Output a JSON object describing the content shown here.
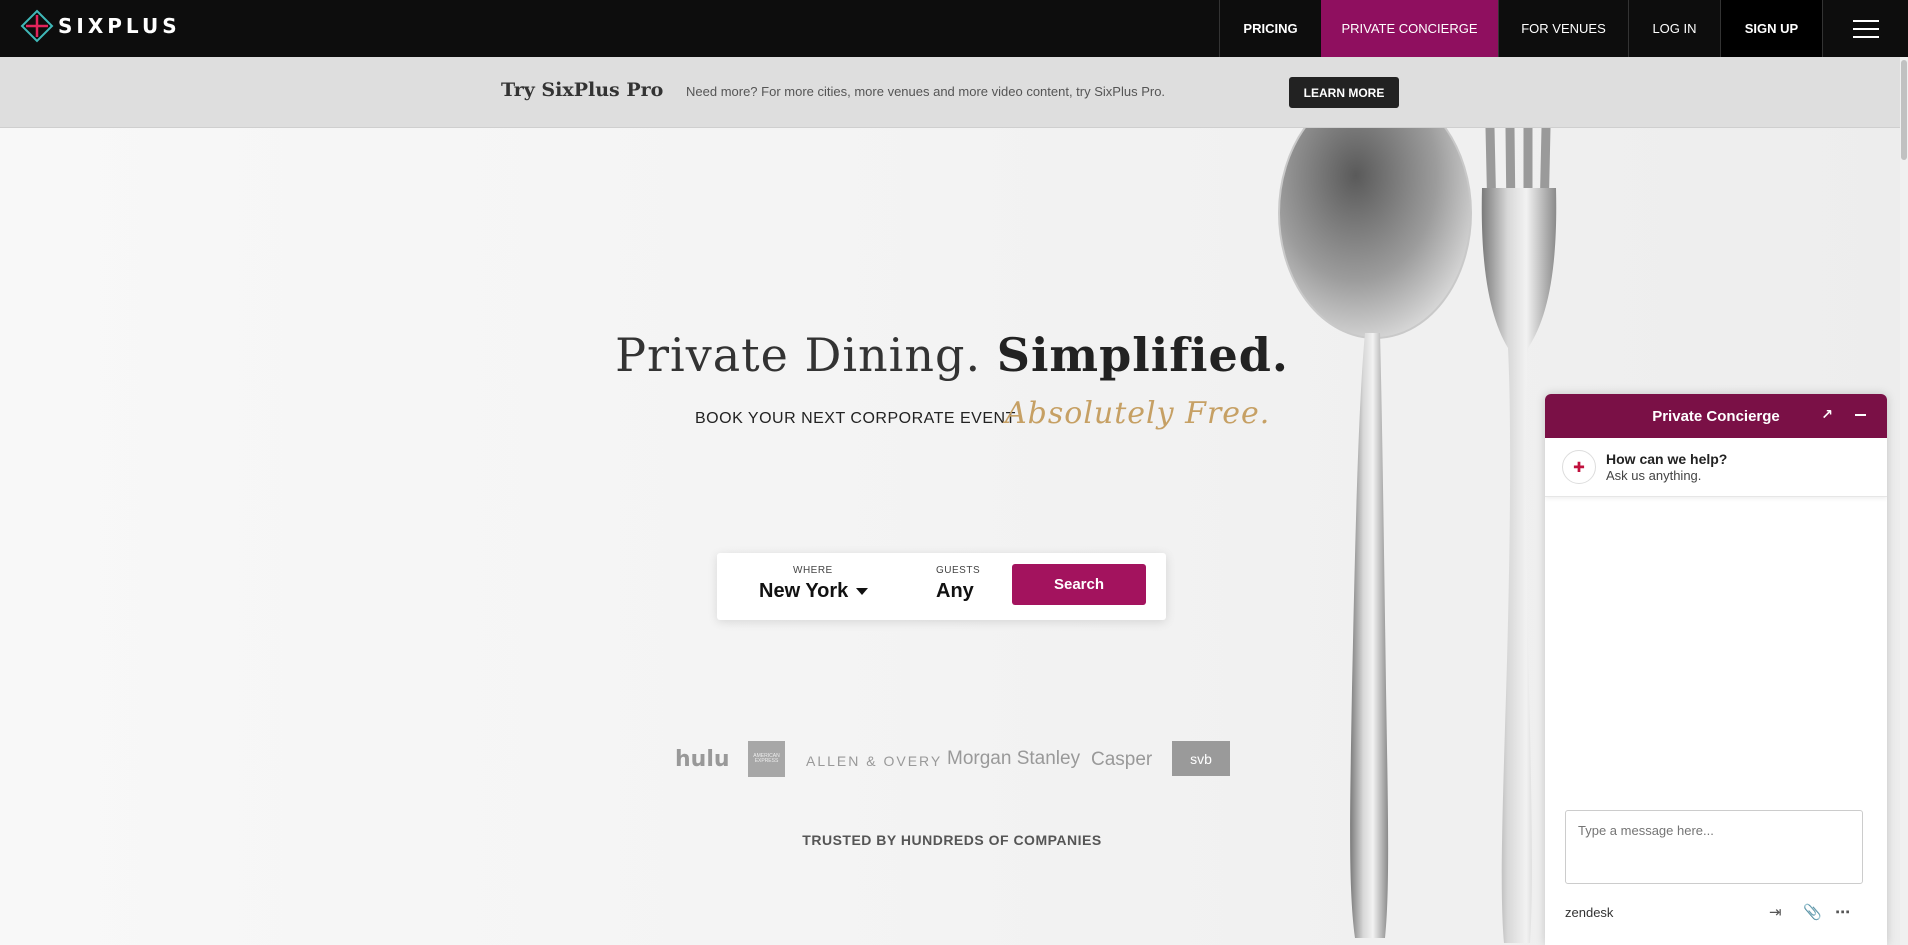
{
  "brand": {
    "name": "SIXPLUS"
  },
  "nav": {
    "links": [
      "PRICING",
      "PRIVATE CONCIERGE",
      "FOR VENUES",
      "LOG IN",
      "SIGN UP"
    ],
    "menu_icon": "hamburger-menu-icon"
  },
  "promo": {
    "title": "Try SixPlus Pro",
    "text": "Need more? For more cities, more venues and more video content, try SixPlus Pro.",
    "button": "LEARN MORE"
  },
  "hero": {
    "headline_regular": "Private Dining. ",
    "headline_bold": "Simplified.",
    "subline": "BOOK YOUR NEXT CORPORATE EVENT",
    "script": "Absolutely Free."
  },
  "search": {
    "where_label": "WHERE",
    "where_value": "New York",
    "guests_label": "GUESTS",
    "guests_value": "Any",
    "button": "Search"
  },
  "trusted": {
    "heading": "TRUSTED BY HUNDREDS OF COMPANIES",
    "logos": [
      "hulu",
      "AMERICAN EXPRESS",
      "ALLEN & OVERY",
      "Morgan Stanley",
      "Casper",
      "svb"
    ]
  },
  "chat": {
    "title": "Private Concierge",
    "greeting_title": "How can we help?",
    "greeting_sub": "Ask us anything.",
    "input_placeholder": "Type a message here...",
    "provider": "zendesk"
  },
  "colors": {
    "accent": "#8f0f5f",
    "search_button": "#a3135e",
    "chat_header": "#7a1046",
    "script_gold": "#c6a064"
  }
}
